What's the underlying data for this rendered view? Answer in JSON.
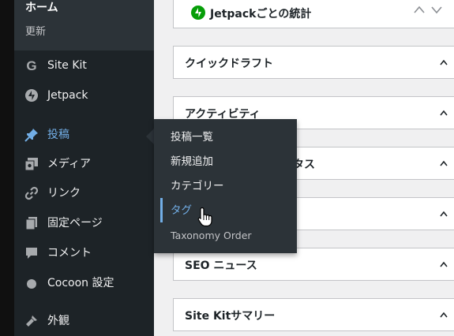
{
  "sidebar": {
    "home": "ホーム",
    "update": "更新",
    "items": [
      {
        "label": "Site Kit",
        "icon": "google-g-icon"
      },
      {
        "label": "Jetpack",
        "icon": "jetpack-bolt-icon"
      },
      {
        "label": "投稿",
        "icon": "pushpin-icon"
      },
      {
        "label": "メディア",
        "icon": "media-icon"
      },
      {
        "label": "リンク",
        "icon": "link-icon"
      },
      {
        "label": "固定ページ",
        "icon": "pages-icon"
      },
      {
        "label": "コメント",
        "icon": "comment-icon"
      },
      {
        "label": "Cocoon 設定",
        "icon": "cocoon-dot-icon"
      },
      {
        "label": "外観",
        "icon": "appearance-brush-icon"
      }
    ]
  },
  "flyout": {
    "items": [
      "投稿一覧",
      "新規追加",
      "カテゴリー",
      "タグ",
      "Taxonomy Order"
    ],
    "current": "タグ"
  },
  "widgets": {
    "jetpack_stats": "Jetpackごとの統計",
    "quick_draft": "クイックドラフト",
    "activity": "アクティビティ",
    "partial_hidden": "タス",
    "seo_news": "SEO ニュース",
    "sitekit_summary": "Site Kitサマリー"
  },
  "colors": {
    "sidebar_bg": "#1d2327",
    "flyout_bg": "#2c3338",
    "accent": "#72aee6",
    "jetpack_green": "#069e08"
  }
}
